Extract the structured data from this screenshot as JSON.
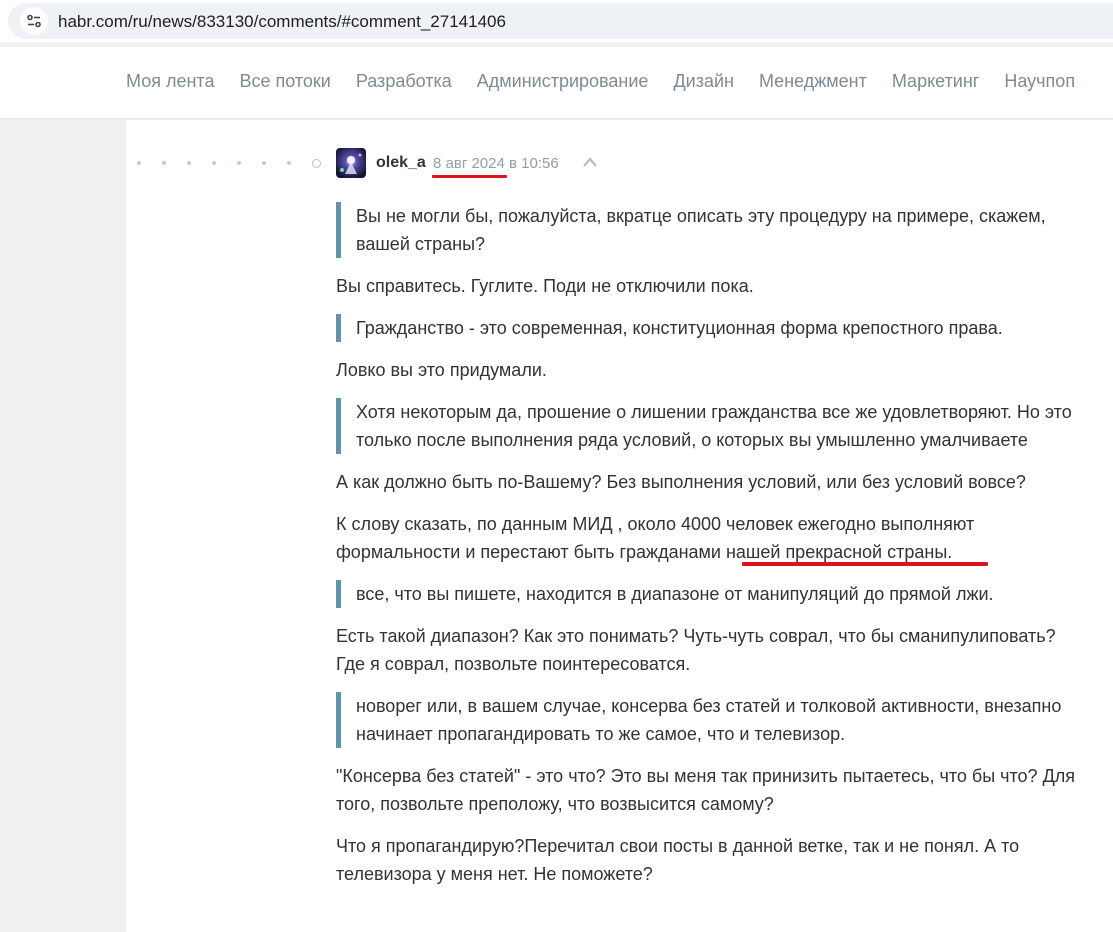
{
  "browser": {
    "url": "habr.com/ru/news/833130/comments/#comment_27141406"
  },
  "nav": {
    "items": [
      "Моя лента",
      "Все потоки",
      "Разработка",
      "Администрирование",
      "Дизайн",
      "Менеджмент",
      "Маркетинг",
      "Научпоп"
    ]
  },
  "comment": {
    "author": "olek_a",
    "date": "8 авг 2024",
    "time_prefix": "в",
    "time": "10:56",
    "blocks": [
      {
        "type": "quote",
        "text": "Вы не могли бы, пожалуйста, вкратце описать эту процедуру на примере, скажем, вашей страны?"
      },
      {
        "type": "para",
        "text": "Вы справитесь. Гуглите. Поди не отключили пока."
      },
      {
        "type": "quote",
        "text": "Гражданство - это современная, конституционная форма крепостного права."
      },
      {
        "type": "para",
        "text": "Ловко вы это придумали."
      },
      {
        "type": "quote",
        "text": "Хотя некоторым да, прошение о лишении гражданства все же удовлетворяют. Но это только после выполнения ряда условий, о которых вы умышленно умалчиваете"
      },
      {
        "type": "para",
        "text": "А как должно быть по-Вашему? Без выполнения условий, или без условий вовсе?"
      },
      {
        "type": "para",
        "text": "К слову сказать, по данным МИД , около 4000 человек ежегодно выполняют формальности и перестают быть гражданами нашей прекрасной страны."
      },
      {
        "type": "quote",
        "text": "все, что вы пишете, находится в диапазоне от манипуляций до прямой лжи."
      },
      {
        "type": "para",
        "text": "Есть такой диапазон? Как это понимать? Чуть-чуть соврал, что бы сманипулиповать? Где я соврал, позвольте поинтересоватся."
      },
      {
        "type": "quote",
        "text": "новорег или, в вашем случае, консерва без статей и толковой активности, внезапно начинает пропагандировать то же самое, что и телевизор."
      },
      {
        "type": "para",
        "text": "\"Консерва без статей\" - это что? Это вы меня так принизить пытаетесь, что бы что? Для того, позвольте преположу, что возвысится самому?"
      },
      {
        "type": "para",
        "text": "Что я пропагандирую?Перечитал свои посты в данной ветке, так и не понял. А то телевизора у меня нет. Не поможете?"
      }
    ]
  },
  "colors": {
    "quote_border": "#5e93ab",
    "annotation_red": "#e0121f",
    "nav_text": "#7f8a93"
  }
}
